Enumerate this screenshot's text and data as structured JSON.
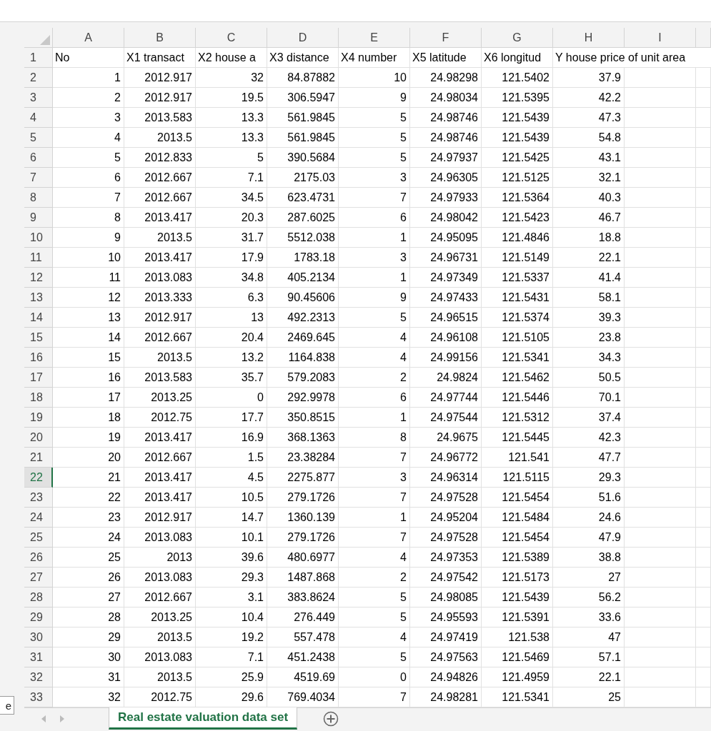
{
  "column_headers": [
    {
      "label": "A",
      "selected": false
    },
    {
      "label": "B",
      "selected": false
    },
    {
      "label": "C",
      "selected": false
    },
    {
      "label": "D",
      "selected": false
    },
    {
      "label": "E",
      "selected": false
    },
    {
      "label": "F",
      "selected": false
    },
    {
      "label": "G",
      "selected": false
    },
    {
      "label": "H",
      "selected": false
    },
    {
      "label": "I",
      "selected": false
    }
  ],
  "rows": [
    {
      "number": "1",
      "selected": false,
      "kind": "header",
      "cells": [
        "No",
        "X1 transact",
        "X2 house a",
        "X3 distance",
        "X4 number",
        "X5 latitude",
        "X6 longitud",
        "Y house price of unit area"
      ]
    },
    {
      "number": "2",
      "selected": false,
      "kind": "data",
      "cells": [
        "1",
        "2012.917",
        "32",
        "84.87882",
        "10",
        "24.98298",
        "121.5402",
        "37.9"
      ]
    },
    {
      "number": "3",
      "selected": false,
      "kind": "data",
      "cells": [
        "2",
        "2012.917",
        "19.5",
        "306.5947",
        "9",
        "24.98034",
        "121.5395",
        "42.2"
      ]
    },
    {
      "number": "4",
      "selected": false,
      "kind": "data",
      "cells": [
        "3",
        "2013.583",
        "13.3",
        "561.9845",
        "5",
        "24.98746",
        "121.5439",
        "47.3"
      ]
    },
    {
      "number": "5",
      "selected": false,
      "kind": "data",
      "cells": [
        "4",
        "2013.5",
        "13.3",
        "561.9845",
        "5",
        "24.98746",
        "121.5439",
        "54.8"
      ]
    },
    {
      "number": "6",
      "selected": false,
      "kind": "data",
      "cells": [
        "5",
        "2012.833",
        "5",
        "390.5684",
        "5",
        "24.97937",
        "121.5425",
        "43.1"
      ]
    },
    {
      "number": "7",
      "selected": false,
      "kind": "data",
      "cells": [
        "6",
        "2012.667",
        "7.1",
        "2175.03",
        "3",
        "24.96305",
        "121.5125",
        "32.1"
      ]
    },
    {
      "number": "8",
      "selected": false,
      "kind": "data",
      "cells": [
        "7",
        "2012.667",
        "34.5",
        "623.4731",
        "7",
        "24.97933",
        "121.5364",
        "40.3"
      ]
    },
    {
      "number": "9",
      "selected": false,
      "kind": "data",
      "cells": [
        "8",
        "2013.417",
        "20.3",
        "287.6025",
        "6",
        "24.98042",
        "121.5423",
        "46.7"
      ]
    },
    {
      "number": "10",
      "selected": false,
      "kind": "data",
      "cells": [
        "9",
        "2013.5",
        "31.7",
        "5512.038",
        "1",
        "24.95095",
        "121.4846",
        "18.8"
      ]
    },
    {
      "number": "11",
      "selected": false,
      "kind": "data",
      "cells": [
        "10",
        "2013.417",
        "17.9",
        "1783.18",
        "3",
        "24.96731",
        "121.5149",
        "22.1"
      ]
    },
    {
      "number": "12",
      "selected": false,
      "kind": "data",
      "cells": [
        "11",
        "2013.083",
        "34.8",
        "405.2134",
        "1",
        "24.97349",
        "121.5337",
        "41.4"
      ]
    },
    {
      "number": "13",
      "selected": false,
      "kind": "data",
      "cells": [
        "12",
        "2013.333",
        "6.3",
        "90.45606",
        "9",
        "24.97433",
        "121.5431",
        "58.1"
      ]
    },
    {
      "number": "14",
      "selected": false,
      "kind": "data",
      "cells": [
        "13",
        "2012.917",
        "13",
        "492.2313",
        "5",
        "24.96515",
        "121.5374",
        "39.3"
      ]
    },
    {
      "number": "15",
      "selected": false,
      "kind": "data",
      "cells": [
        "14",
        "2012.667",
        "20.4",
        "2469.645",
        "4",
        "24.96108",
        "121.5105",
        "23.8"
      ]
    },
    {
      "number": "16",
      "selected": false,
      "kind": "data",
      "cells": [
        "15",
        "2013.5",
        "13.2",
        "1164.838",
        "4",
        "24.99156",
        "121.5341",
        "34.3"
      ]
    },
    {
      "number": "17",
      "selected": false,
      "kind": "data",
      "cells": [
        "16",
        "2013.583",
        "35.7",
        "579.2083",
        "2",
        "24.9824",
        "121.5462",
        "50.5"
      ]
    },
    {
      "number": "18",
      "selected": false,
      "kind": "data",
      "cells": [
        "17",
        "2013.25",
        "0",
        "292.9978",
        "6",
        "24.97744",
        "121.5446",
        "70.1"
      ]
    },
    {
      "number": "19",
      "selected": false,
      "kind": "data",
      "cells": [
        "18",
        "2012.75",
        "17.7",
        "350.8515",
        "1",
        "24.97544",
        "121.5312",
        "37.4"
      ]
    },
    {
      "number": "20",
      "selected": false,
      "kind": "data",
      "cells": [
        "19",
        "2013.417",
        "16.9",
        "368.1363",
        "8",
        "24.9675",
        "121.5445",
        "42.3"
      ]
    },
    {
      "number": "21",
      "selected": false,
      "kind": "data",
      "cells": [
        "20",
        "2012.667",
        "1.5",
        "23.38284",
        "7",
        "24.96772",
        "121.541",
        "47.7"
      ]
    },
    {
      "number": "22",
      "selected": true,
      "kind": "data",
      "cells": [
        "21",
        "2013.417",
        "4.5",
        "2275.877",
        "3",
        "24.96314",
        "121.5115",
        "29.3"
      ]
    },
    {
      "number": "23",
      "selected": false,
      "kind": "data",
      "cells": [
        "22",
        "2013.417",
        "10.5",
        "279.1726",
        "7",
        "24.97528",
        "121.5454",
        "51.6"
      ]
    },
    {
      "number": "24",
      "selected": false,
      "kind": "data",
      "cells": [
        "23",
        "2012.917",
        "14.7",
        "1360.139",
        "1",
        "24.95204",
        "121.5484",
        "24.6"
      ]
    },
    {
      "number": "25",
      "selected": false,
      "kind": "data",
      "cells": [
        "24",
        "2013.083",
        "10.1",
        "279.1726",
        "7",
        "24.97528",
        "121.5454",
        "47.9"
      ]
    },
    {
      "number": "26",
      "selected": false,
      "kind": "data",
      "cells": [
        "25",
        "2013",
        "39.6",
        "480.6977",
        "4",
        "24.97353",
        "121.5389",
        "38.8"
      ]
    },
    {
      "number": "27",
      "selected": false,
      "kind": "data",
      "cells": [
        "26",
        "2013.083",
        "29.3",
        "1487.868",
        "2",
        "24.97542",
        "121.5173",
        "27"
      ]
    },
    {
      "number": "28",
      "selected": false,
      "kind": "data",
      "cells": [
        "27",
        "2012.667",
        "3.1",
        "383.8624",
        "5",
        "24.98085",
        "121.5439",
        "56.2"
      ]
    },
    {
      "number": "29",
      "selected": false,
      "kind": "data",
      "cells": [
        "28",
        "2013.25",
        "10.4",
        "276.449",
        "5",
        "24.95593",
        "121.5391",
        "33.6"
      ]
    },
    {
      "number": "30",
      "selected": false,
      "kind": "data",
      "cells": [
        "29",
        "2013.5",
        "19.2",
        "557.478",
        "4",
        "24.97419",
        "121.538",
        "47"
      ]
    },
    {
      "number": "31",
      "selected": false,
      "kind": "data",
      "cells": [
        "30",
        "2013.083",
        "7.1",
        "451.2438",
        "5",
        "24.97563",
        "121.5469",
        "57.1"
      ]
    },
    {
      "number": "32",
      "selected": false,
      "kind": "data",
      "cells": [
        "31",
        "2013.5",
        "25.9",
        "4519.69",
        "0",
        "24.94826",
        "121.4959",
        "22.1"
      ]
    },
    {
      "number": "33",
      "selected": false,
      "kind": "data",
      "cells": [
        "32",
        "2012.75",
        "29.6",
        "769.4034",
        "7",
        "24.98281",
        "121.5341",
        "25"
      ]
    }
  ],
  "side_button": {
    "label": "e"
  },
  "sheet_tabs": [
    {
      "label": "Real estate valuation data set",
      "selected": true
    }
  ]
}
